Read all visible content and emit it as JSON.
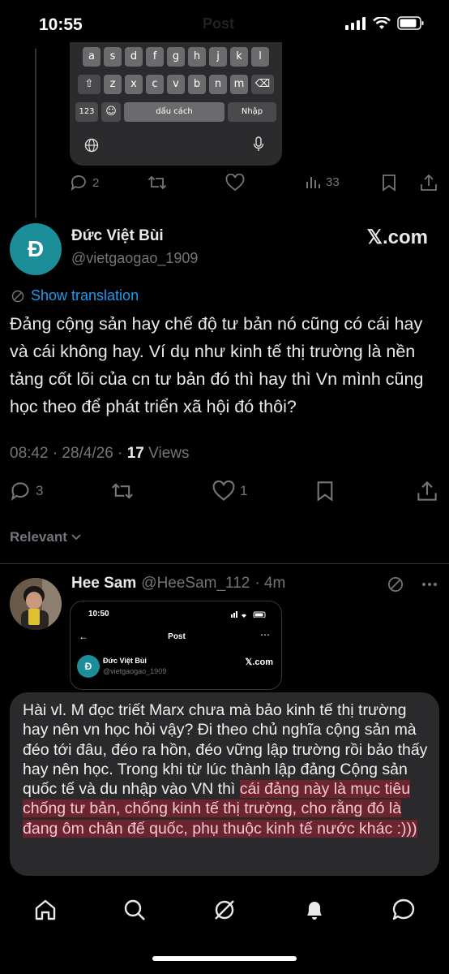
{
  "status_bar": {
    "time": "10:55",
    "ghost_title": "Post"
  },
  "keyboard": {
    "row1": [
      "a",
      "s",
      "d",
      "f",
      "g",
      "h",
      "j",
      "k",
      "l"
    ],
    "row2": [
      "z",
      "x",
      "c",
      "v",
      "b",
      "n",
      "m"
    ],
    "num_key": "123",
    "space_label": "dấu cách",
    "enter_label": "Nhập"
  },
  "top_actions": {
    "replies": "2",
    "views": "33"
  },
  "tweet": {
    "avatar_letter": "Đ",
    "author_name": "Đức Việt Bùi",
    "author_handle": "@vietgaogao_1909",
    "source_mark": "𝕏.com",
    "show_translation": "Show translation",
    "body": "Đảng cộng sản hay chế độ tư bản nó cũng có cái hay và cái không hay. Ví dụ như kinh tế thị trường là nền tảng cốt lõi của cn tư bản đó thì hay thì Vn mình cũng học theo để phát triển xã hội đó thôi?",
    "timestamp": "08:42 · 28/4/26 · ",
    "views_count": "17",
    "views_label": " Views",
    "reply_count": "3",
    "like_count": "1"
  },
  "sort": {
    "label": "Relevant"
  },
  "reply": {
    "name": "Hee Sam",
    "handle": "@HeeSam_112",
    "time": "· 4m"
  },
  "embedded_shot": {
    "time": "10:50",
    "title": "Post",
    "avatar_letter": "Đ",
    "name": "Đức Việt Bùi",
    "handle": "@vietgaogao_1909",
    "mark": "𝕏.com"
  },
  "comment": {
    "plain": "Hài vl. M đọc triết Marx chưa mà bảo kinh tế thị trường hay nên vn học hỏi vậy? Đi theo chủ nghĩa cộng sản mà đéo tới đâu, đéo ra hồn, đéo vững lập trường rồi bảo thấy hay nên học. Trong khi từ lúc thành lập đảng Cộng sản quốc tế và du nhập vào VN thì ",
    "highlighted": "cái đảng này là mục tiêu chống tư bản, chống kinh tế thị trường, cho rằng đó là đang ôm chân đế quốc, phụ thuộc kinh tế nước khác :)))"
  },
  "colors": {
    "accent": "#1d9bf0",
    "muted": "#71767b",
    "avatar_teal": "#1b8e9a",
    "highlight": "#6b2430",
    "comment_bg": "#2a2a2c"
  },
  "nav": [
    "home-icon",
    "search-icon",
    "grok-icon",
    "notifications-icon",
    "messages-icon"
  ]
}
